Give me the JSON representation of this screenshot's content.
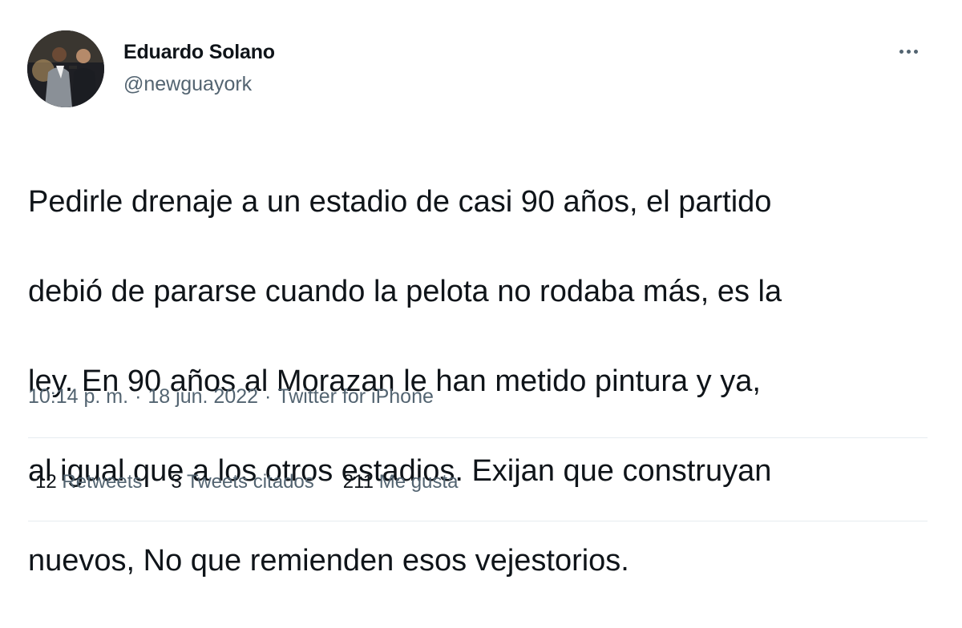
{
  "author": {
    "display_name": "Eduardo Solano",
    "handle": "@newguayork",
    "avatar_icon": "user-avatar-photo"
  },
  "menu_icon": "more-options-icon",
  "tweet": {
    "lines": [
      "Pedirle drenaje a un estadio de casi 90 años, el partido",
      "debió de pararse cuando la pelota no rodaba más, es la",
      "ley. En 90 años al Morazan le han metido pintura y ya,",
      "al igual que a los otros estadios. Exijan que construyan",
      "nuevos, No que remienden esos vejestorios."
    ]
  },
  "meta": {
    "time": "10:14 p. m.",
    "separator": "·",
    "date": "18 jun. 2022",
    "source": "Twitter for iPhone"
  },
  "stats": {
    "retweets_count": "12",
    "retweets_label": "Retweets",
    "quotes_count": "3",
    "quotes_label": "Tweets citados",
    "likes_count": "211",
    "likes_label": "Me gusta"
  },
  "colors": {
    "text_primary": "#0f1419",
    "text_secondary": "#536471",
    "divider": "#e6ecf0"
  }
}
